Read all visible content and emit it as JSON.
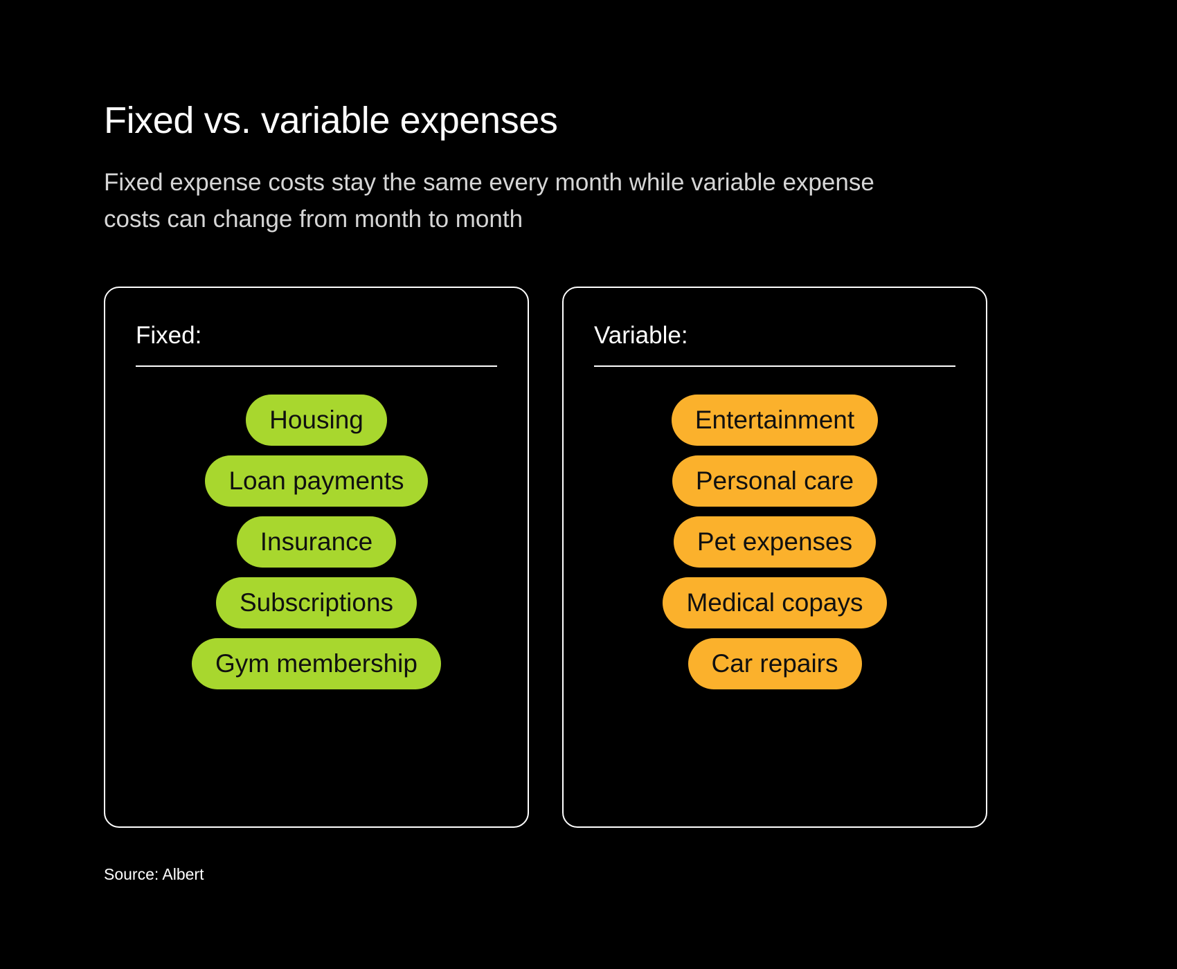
{
  "header": {
    "title": "Fixed vs. variable expenses",
    "subtitle": "Fixed expense costs stay the same every month while variable expense costs can change from month to month"
  },
  "panels": [
    {
      "heading": "Fixed:",
      "accent_color": "#A8D72E",
      "items": [
        "Housing",
        "Loan payments",
        "Insurance",
        "Subscriptions",
        "Gym membership"
      ]
    },
    {
      "heading": "Variable:",
      "accent_color": "#FBB12C",
      "items": [
        "Entertainment",
        "Personal care",
        "Pet expenses",
        "Medical copays",
        "Car repairs"
      ]
    }
  ],
  "footer": {
    "source": "Source: Albert"
  },
  "theme": {
    "background": "#000000",
    "text": "#FFFFFF",
    "subtitle_text": "#D6D6D6",
    "pill_text": "#101010",
    "border": "#FFFFFF"
  }
}
